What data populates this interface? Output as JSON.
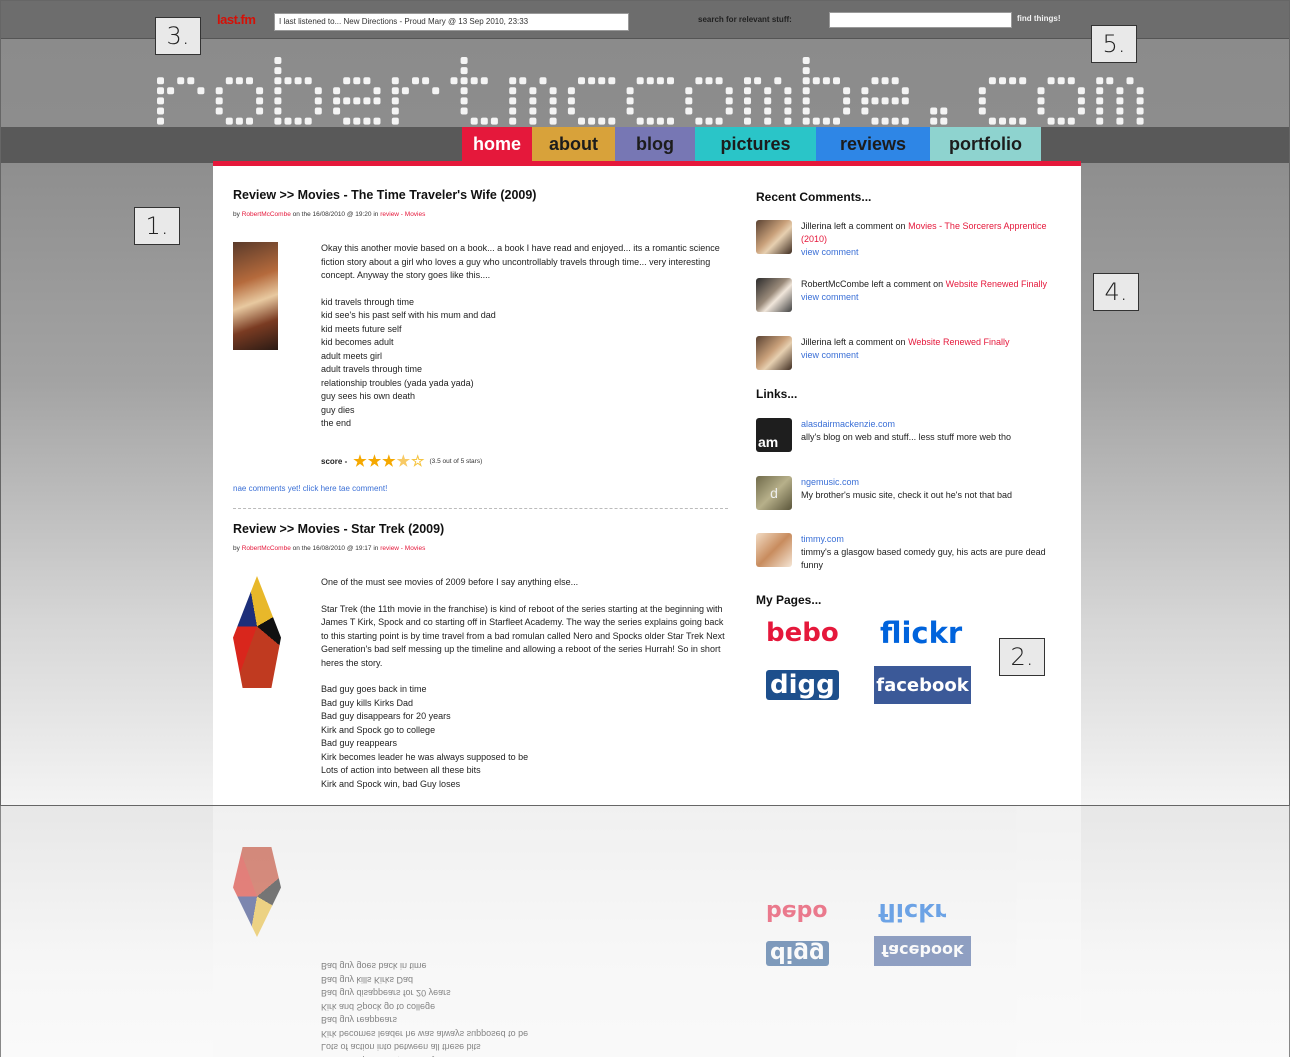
{
  "topbar": {
    "lastfm_label": "last.fm",
    "now_playing": "I last listened to... New Directions - Proud Mary @ 13 Sep 2010, 23:33",
    "search_label": "search for relevant stuff:",
    "search_placeholder": "",
    "find_button": "find things!"
  },
  "site_title": "robertmccombe.com",
  "nav": [
    {
      "label": "home",
      "color": "#e5183b",
      "text_color": "#ffffff"
    },
    {
      "label": "about",
      "color": "#d8a23a",
      "text_color": "#1c1c1c"
    },
    {
      "label": "blog",
      "color": "#7777b4",
      "text_color": "#1c1c1c"
    },
    {
      "label": "pictures",
      "color": "#2ac5c8",
      "text_color": "#1c1c1c"
    },
    {
      "label": "reviews",
      "color": "#2e86e6",
      "text_color": "#1c1c1c"
    },
    {
      "label": "portfolio",
      "color": "#8ed3cf",
      "text_color": "#1c1c1c"
    }
  ],
  "posts": [
    {
      "title": "Review >> Movies - The Time Traveler's Wife (2009)",
      "byline_prefix": "by",
      "author": "RobertMcCombe",
      "byline_mid": "on the 16/08/2010 @ 19:20 in",
      "category": "review - Movies",
      "intro": "Okay this another movie based on a book... a book I have read and enjoyed... its a romantic science fiction story about a girl who loves a guy who uncontrollably travels through time... very interesting concept.  Anyway the story goes like this....",
      "lines": [
        "kid travels through time",
        "kid see's his past self with his mum and dad",
        "kid meets future self",
        "kid becomes adult",
        "adult meets girl",
        "adult travels through time",
        "relationship troubles (yada yada yada)",
        "guy sees his own death",
        "guy dies",
        "the end"
      ],
      "score_label": "score -",
      "rating": 3.5,
      "score_text": "(3.5 out of 5 stars)",
      "no_comments": "nae comments yet! click here tae comment!"
    },
    {
      "title": "Review >> Movies - Star Trek (2009)",
      "byline_prefix": "by",
      "author": "RobertMcCombe",
      "byline_mid": "on the 16/08/2010 @ 19:17 in",
      "category": "review - Movies",
      "intro": "One of the must see movies of 2009 before I say anything else...",
      "para": "Star Trek (the 11th movie in the franchise) is kind of reboot of the series starting at the beginning with James T Kirk, Spock and co starting off in Starfleet Academy.  The way the series explains going back to this starting point is by time travel from a bad romulan called Nero and Spocks older  Star Trek Next Generation's bad self messing up the timeline and allowing a reboot of the series Hurrah! So in short heres the story.",
      "lines": [
        "Bad guy goes back in time",
        "Bad guy kills Kirks Dad",
        "Bad guy disappears for 20 years",
        "Kirk and Spock go to college",
        "Bad guy reappears",
        "Kirk becomes leader he was always supposed to be",
        "Lots of action into between all these bits",
        "Kirk and Spock win, bad Guy loses"
      ]
    }
  ],
  "sidebar": {
    "recent_title": "Recent Comments...",
    "comments": [
      {
        "user": "Jillerina",
        "mid": "left a comment on",
        "target": "Movies - The Sorcerers Apprentice (2010)",
        "view": "view comment"
      },
      {
        "user": "RobertMcCombe",
        "mid": "left a comment on",
        "target": "Website Renewed Finally",
        "view": "view comment"
      },
      {
        "user": "Jillerina",
        "mid": "left a comment on",
        "target": "Website Renewed Finally",
        "view": "view comment"
      }
    ],
    "links_title": "Links...",
    "links": [
      {
        "url": "alasdairmackenzie.com",
        "desc": "ally's blog on web and stuff... less stuff more web tho",
        "icon_text": "am"
      },
      {
        "url": "ngemusic.com",
        "desc": "My brother's music site, check it out he's not that bad",
        "icon_text": "d"
      },
      {
        "url": "timmy.com",
        "desc": "timmy's a glasgow based comedy guy, his acts are pure dead funny",
        "icon_text": ""
      }
    ],
    "pages_title": "My Pages...",
    "pages": [
      {
        "label": "bebo",
        "color": "#e5183b"
      },
      {
        "label": "flickr",
        "color": "#0063dc"
      },
      {
        "label": "digg",
        "color": "#1d4f8c"
      },
      {
        "label": "facebook",
        "color": "#3b5998"
      }
    ]
  },
  "callouts": [
    "1.",
    "2.",
    "3.",
    "4.",
    "5."
  ]
}
